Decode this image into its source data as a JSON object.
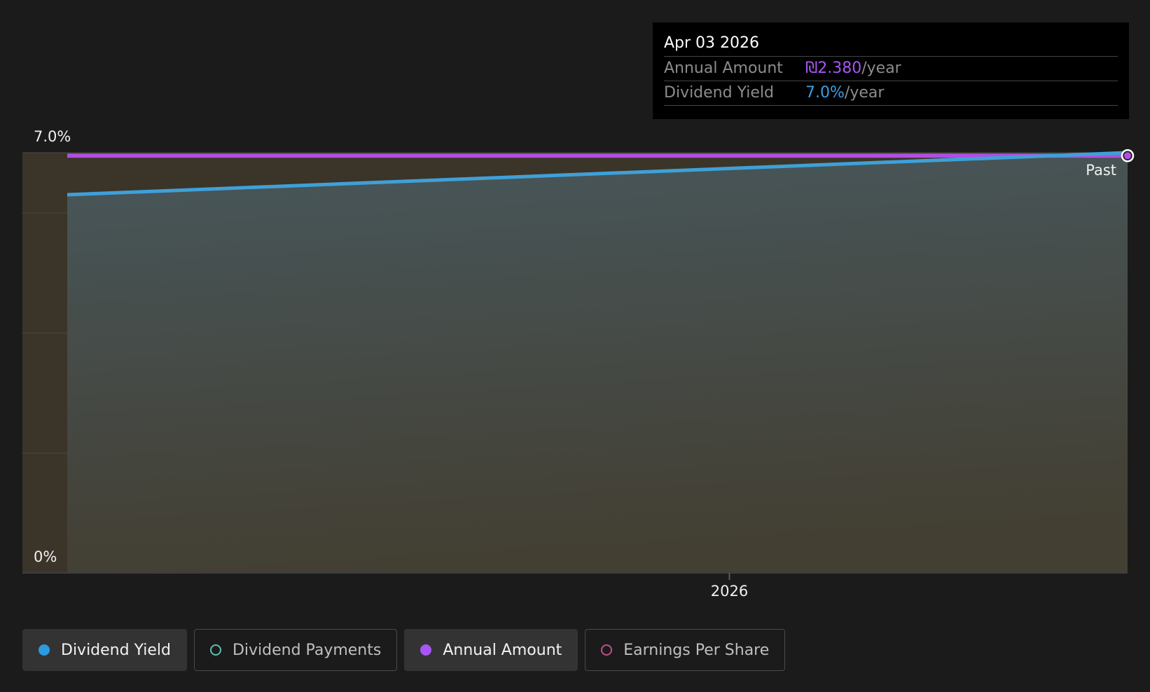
{
  "chart_data": {
    "type": "area",
    "x_tick_labels": [
      "2026"
    ],
    "y_tick_labels": [
      "7.0%",
      "0%"
    ],
    "ylim": [
      0,
      7.0
    ],
    "x_domain": [
      "2025-08-01",
      "2026-04-03"
    ],
    "series": [
      {
        "name": "Dividend Yield",
        "color": "#3fa0d8",
        "x": [
          "2025-08-01",
          "2026-04-03"
        ],
        "values": [
          6.3,
          7.0
        ]
      },
      {
        "name": "Annual Amount",
        "color": "#b04fe0",
        "x": [
          "2025-08-01",
          "2026-04-03"
        ],
        "values": [
          6.95,
          6.95
        ]
      }
    ],
    "x_ticks": [
      "2026-01-01"
    ],
    "annotations": {
      "past_label": "Past"
    },
    "grid": true
  },
  "tooltip": {
    "date": "Apr 03 2026",
    "rows": [
      {
        "label": "Annual Amount",
        "value": "₪2.380",
        "unit": "/year",
        "color": "#a855f7"
      },
      {
        "label": "Dividend Yield",
        "value": "7.0%",
        "unit": "/year",
        "color": "#3b9fe8"
      }
    ]
  },
  "legend": [
    {
      "label": "Dividend Yield",
      "color": "#2b9be0",
      "active": true,
      "icon": "filled-dot-icon"
    },
    {
      "label": "Dividend Payments",
      "color": "#5fbfb0",
      "active": false,
      "icon": "hollow-dot-icon"
    },
    {
      "label": "Annual Amount",
      "color": "#a855f7",
      "active": true,
      "icon": "filled-dot-icon"
    },
    {
      "label": "Earnings Per Share",
      "color": "#c0508a",
      "active": false,
      "icon": "hollow-dot-icon"
    }
  ]
}
